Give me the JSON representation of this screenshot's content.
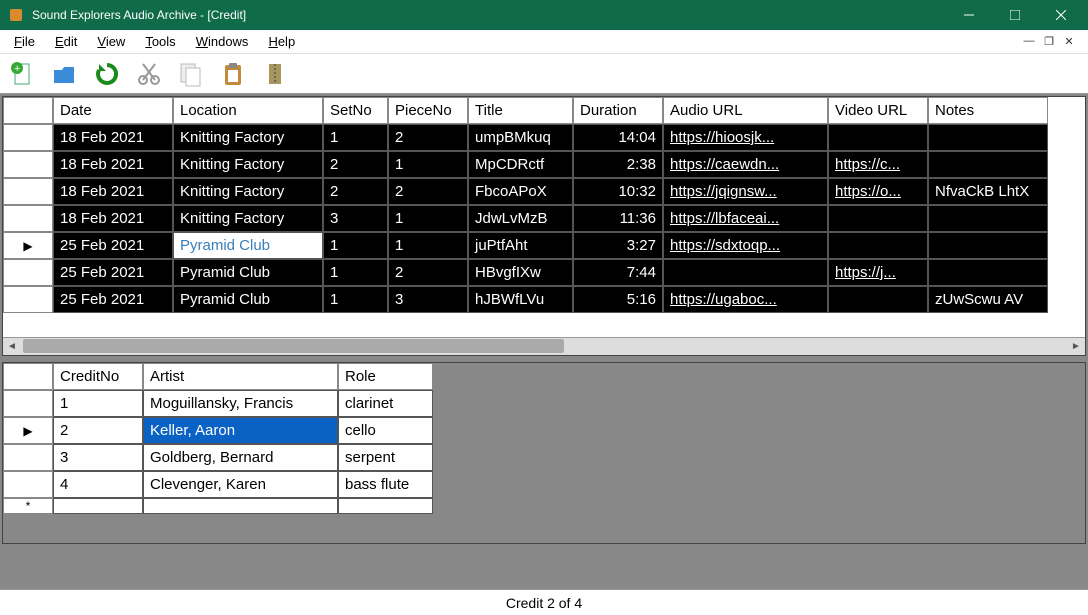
{
  "window": {
    "title": "Sound Explorers Audio Archive - [Credit]"
  },
  "menu": {
    "file": "File",
    "edit": "Edit",
    "view": "View",
    "tools": "Tools",
    "windows": "Windows",
    "help": "Help"
  },
  "top_table": {
    "headers": {
      "date": "Date",
      "location": "Location",
      "setno": "SetNo",
      "pieceno": "PieceNo",
      "title": "Title",
      "duration": "Duration",
      "audio": "Audio URL",
      "video": "Video URL",
      "notes": "Notes"
    },
    "rows": [
      {
        "date": "18 Feb 2021",
        "location": "Knitting Factory",
        "setno": "1",
        "pieceno": "2",
        "title": "umpBMkuq",
        "duration": "14:04",
        "audio": "https://hioosjk...",
        "video": "",
        "notes": ""
      },
      {
        "date": "18 Feb 2021",
        "location": "Knitting Factory",
        "setno": "2",
        "pieceno": "1",
        "title": "MpCDRctf",
        "duration": "2:38",
        "audio": "https://caewdn...",
        "video": "https://c...",
        "notes": ""
      },
      {
        "date": "18 Feb 2021",
        "location": "Knitting Factory",
        "setno": "2",
        "pieceno": "2",
        "title": "FbcoAPoX",
        "duration": "10:32",
        "audio": "https://jqignsw...",
        "video": "https://o...",
        "notes": "NfvaCkB LhtX"
      },
      {
        "date": "18 Feb 2021",
        "location": "Knitting Factory",
        "setno": "3",
        "pieceno": "1",
        "title": "JdwLvMzB",
        "duration": "11:36",
        "audio": "https://lbfaceai...",
        "video": "",
        "notes": ""
      },
      {
        "date": "25 Feb 2021",
        "location": "Pyramid Club",
        "setno": "1",
        "pieceno": "1",
        "title": "juPtfAht",
        "duration": "3:27",
        "audio": "https://sdxtoqp...",
        "video": "",
        "notes": "",
        "selected": true
      },
      {
        "date": "25 Feb 2021",
        "location": "Pyramid Club",
        "setno": "1",
        "pieceno": "2",
        "title": "HBvgfIXw",
        "duration": "7:44",
        "audio": "",
        "video": "https://j...",
        "notes": ""
      },
      {
        "date": "25 Feb 2021",
        "location": "Pyramid Club",
        "setno": "1",
        "pieceno": "3",
        "title": "hJBWfLVu",
        "duration": "5:16",
        "audio": "https://ugaboc...",
        "video": "",
        "notes": "zUwScwu AV"
      }
    ]
  },
  "bot_table": {
    "headers": {
      "creditno": "CreditNo",
      "artist": "Artist",
      "role": "Role"
    },
    "rows": [
      {
        "no": "1",
        "artist": "Moguillansky, Francis",
        "role": "clarinet"
      },
      {
        "no": "2",
        "artist": "Keller, Aaron",
        "role": "cello",
        "selected": true
      },
      {
        "no": "3",
        "artist": "Goldberg, Bernard",
        "role": "serpent"
      },
      {
        "no": "4",
        "artist": "Clevenger, Karen",
        "role": "bass flute"
      }
    ]
  },
  "status": "Credit 2 of 4"
}
